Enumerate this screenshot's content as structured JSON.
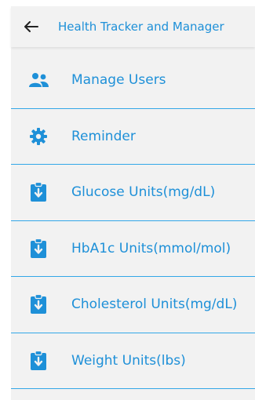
{
  "header": {
    "title": "Health Tracker and Manager",
    "back_icon": "arrow-left-icon"
  },
  "colors": {
    "accent": "#1e90d8",
    "divider": "#33a7e8",
    "background": "#f2f2f2"
  },
  "menu": {
    "items": [
      {
        "label": "Manage Users",
        "icon": "users-icon"
      },
      {
        "label": "Reminder",
        "icon": "gear-icon"
      },
      {
        "label": "Glucose Units(mg/dL)",
        "icon": "clipboard-download-icon"
      },
      {
        "label": "HbA1c Units(mmol/mol)",
        "icon": "clipboard-download-icon"
      },
      {
        "label": "Cholesterol Units(mg/dL)",
        "icon": "clipboard-download-icon"
      },
      {
        "label": "Weight Units(lbs)",
        "icon": "clipboard-download-icon"
      }
    ]
  }
}
